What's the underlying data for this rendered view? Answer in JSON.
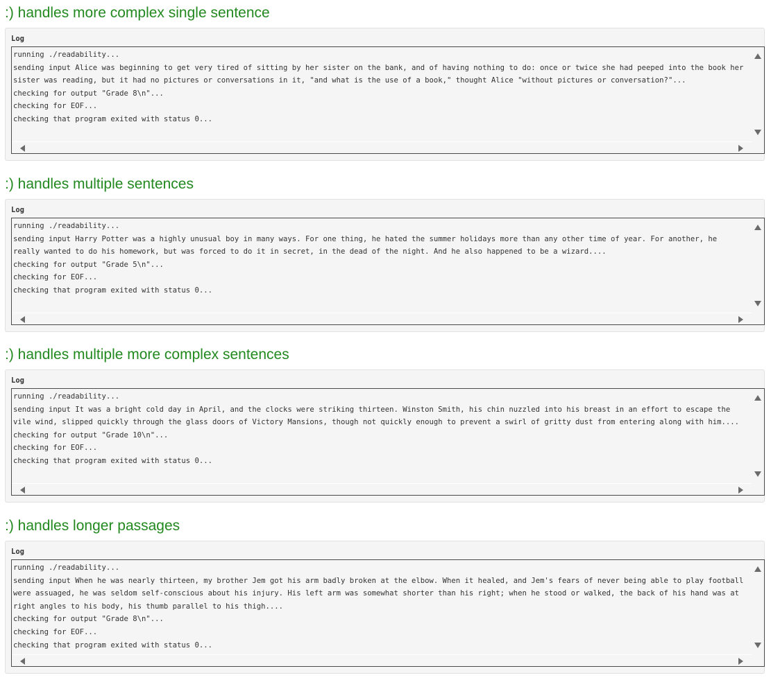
{
  "checks": [
    {
      "title": ":) handles more complex single sentence",
      "log_label": "Log",
      "log_text": "running ./readability...\nsending input Alice was beginning to get very tired of sitting by her sister on the bank, and of having nothing to do: once or twice she had peeped into the book her sister was reading, but it had no pictures or conversations in it, \"and what is the use of a book,\" thought Alice \"without pictures or conversation?\"...\nchecking for output \"Grade 8\\n\"...\nchecking for EOF...\nchecking that program exited with status 0..."
    },
    {
      "title": ":) handles multiple sentences",
      "log_label": "Log",
      "log_text": "running ./readability...\nsending input Harry Potter was a highly unusual boy in many ways. For one thing, he hated the summer holidays more than any other time of year. For another, he really wanted to do his homework, but was forced to do it in secret, in the dead of the night. And he also happened to be a wizard....\nchecking for output \"Grade 5\\n\"...\nchecking for EOF...\nchecking that program exited with status 0..."
    },
    {
      "title": ":) handles multiple more complex sentences",
      "log_label": "Log",
      "log_text": "running ./readability...\nsending input It was a bright cold day in April, and the clocks were striking thirteen. Winston Smith, his chin nuzzled into his breast in an effort to escape the vile wind, slipped quickly through the glass doors of Victory Mansions, though not quickly enough to prevent a swirl of gritty dust from entering along with him....\nchecking for output \"Grade 10\\n\"...\nchecking for EOF...\nchecking that program exited with status 0..."
    },
    {
      "title": ":) handles longer passages",
      "log_label": "Log",
      "log_text": "running ./readability...\nsending input When he was nearly thirteen, my brother Jem got his arm badly broken at the elbow. When it healed, and Jem's fears of never being able to play football were assuaged, he was seldom self-conscious about his injury. His left arm was somewhat shorter than his right; when he stood or walked, the back of his hand was at right angles to his body, his thumb parallel to his thigh....\nchecking for output \"Grade 8\\n\"...\nchecking for EOF...\nchecking that program exited with status 0..."
    }
  ],
  "colors": {
    "pass_title": "#22891f",
    "panel_bg": "#f5f5f5",
    "log_border": "#4a4a4a"
  },
  "icons": {
    "scroll_up": "triangle-up-icon",
    "scroll_down": "triangle-down-icon",
    "scroll_left": "triangle-left-icon",
    "scroll_right": "triangle-right-icon"
  }
}
